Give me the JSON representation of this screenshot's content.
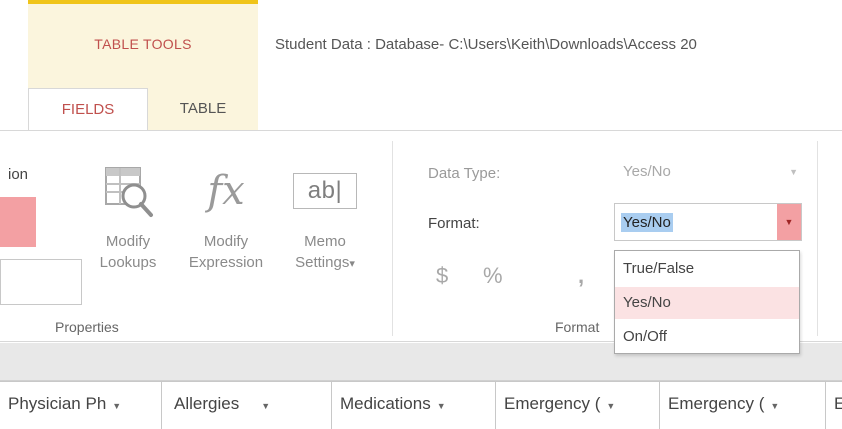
{
  "header": {
    "context_group_label": "TABLE TOOLS",
    "window_title": "Student Data : Database- C:\\Users\\Keith\\Downloads\\Access 20",
    "tabs": [
      {
        "label": "FIELDS",
        "active": true
      },
      {
        "label": "TABLE",
        "active": false
      }
    ]
  },
  "ribbon": {
    "partial_label": "ion",
    "buttons": {
      "modify_lookups": {
        "line1": "Modify",
        "line2": "Lookups",
        "icon": "modify-lookups-icon"
      },
      "modify_expression": {
        "line1": "Modify",
        "line2": "Expression",
        "icon": "fx-icon",
        "glyph": "fx"
      },
      "memo_settings": {
        "line1": "Memo",
        "line2": "Settings",
        "icon": "memo-ab-icon",
        "glyph": "ab|",
        "caret": "▾"
      }
    },
    "properties_group_label": "Properties",
    "data_type": {
      "label": "Data Type:",
      "value": "Yes/No"
    },
    "format": {
      "label": "Format:",
      "value": "Yes/No",
      "options": [
        "True/False",
        "Yes/No",
        "On/Off"
      ],
      "selected_index": 1
    },
    "format_buttons": {
      "currency": "$",
      "percent": "%",
      "comma": ","
    },
    "format_group_label": "Format",
    "colors": {
      "accent": "#c0504d",
      "context_bg": "#fbf5dd",
      "context_border": "#f0c419",
      "selection": "#a9cdf0",
      "hover": "#fbe2e3",
      "dropdown_arrow_bg": "#f3a0a3"
    }
  },
  "datasheet": {
    "columns": [
      "Physician Ph",
      "Allergies",
      "Medications",
      "Emergency (",
      "Emergency (",
      "E"
    ],
    "dropdown_glyph": "▾"
  }
}
